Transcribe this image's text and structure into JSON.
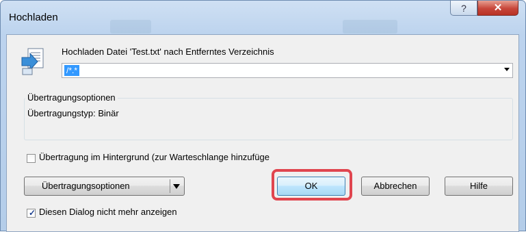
{
  "window": {
    "title": "Hochladen",
    "help_glyph": "?",
    "close_glyph": "✕"
  },
  "upload": {
    "heading": "Hochladen Datei 'Test.txt' nach Entferntes Verzeichnis",
    "path_value": "/*.*",
    "icon": "upload-file-icon"
  },
  "transfer_options_group": {
    "legend": "Übertragungsoptionen",
    "line": "Übertragungstyp: Binär"
  },
  "background_checkbox": {
    "label": "Übertragung im Hintergrund (zur Warteschlange hinzufüge",
    "checked": false
  },
  "buttons": {
    "options": "Übertragungsoptionen",
    "ok": "OK",
    "cancel": "Abbrechen",
    "help": "Hilfe"
  },
  "dont_show_checkbox": {
    "label": "Diesen Dialog nicht mehr anzeigen",
    "checked": true
  },
  "colors": {
    "highlight": "#e0454f",
    "selection": "#3399ff",
    "close_button": "#c7463a"
  }
}
